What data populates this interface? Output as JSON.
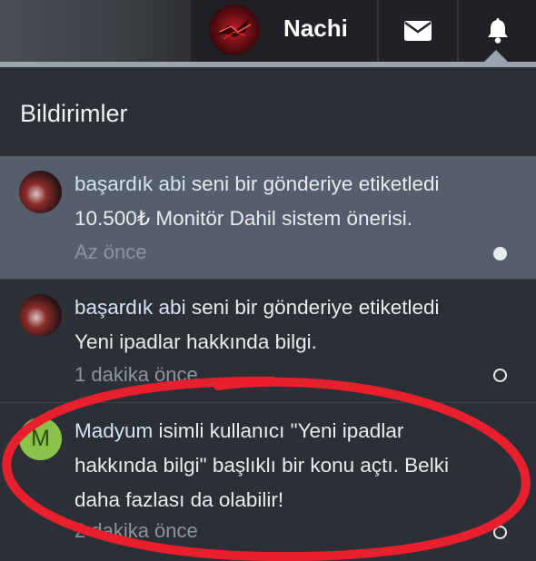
{
  "topbar": {
    "username": "Nachi",
    "messages_icon": "envelope-icon",
    "notifications_icon": "bell-icon"
  },
  "panel": {
    "title": "Bildirimler"
  },
  "notifications": [
    {
      "actor": "başardık abi",
      "action": "seni bir gönderiye etiketledi",
      "subject": "10.500₺ Monitör Dahil sistem önerisi.",
      "time": "Az önce",
      "unread": true
    },
    {
      "actor": "başardık abi",
      "action": "seni bir gönderiye etiketledi",
      "subject": "Yeni ipadlar hakkında bilgi.",
      "time": "1 dakika önce",
      "unread": false
    },
    {
      "actor": "Madyum",
      "avatar_letter": "M",
      "line1_pre": "isimli kullanıcı ",
      "line1_quote": "\"Yeni ipadlar",
      "line2": "hakkında bilgi\" başlıklı bir konu açtı. Belki",
      "line3": "daha fazlası da olabilir!",
      "time": "2 dakika önce",
      "unread": false
    }
  ],
  "colors": {
    "accent_ring": "#e8202e",
    "unread_bg": "#555e6b",
    "avatar_green": "#8bc34a"
  }
}
